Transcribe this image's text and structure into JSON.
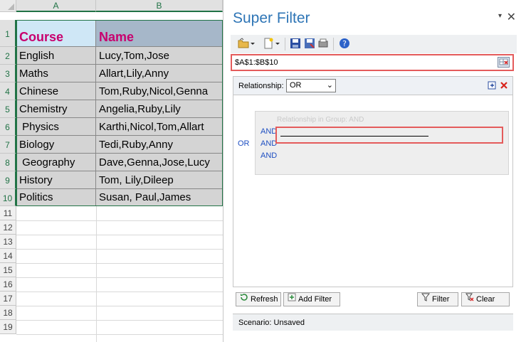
{
  "sheet": {
    "columns": [
      "A",
      "B"
    ],
    "rows": [
      "1",
      "2",
      "3",
      "4",
      "5",
      "6",
      "7",
      "8",
      "9",
      "10",
      "11",
      "12",
      "13",
      "14",
      "15",
      "16",
      "17",
      "18",
      "19"
    ],
    "header": {
      "course": "Course",
      "name": "Name"
    },
    "data": [
      [
        "English",
        "Lucy,Tom,Jose"
      ],
      [
        "Maths",
        "Allart,Lily,Anny"
      ],
      [
        "Chinese",
        "Tom,Ruby,Nicol,Genna"
      ],
      [
        "Chemistry",
        "Angelia,Ruby,Lily"
      ],
      [
        " Physics",
        "Karthi,Nicol,Tom,Allart"
      ],
      [
        "Biology",
        "Tedi,Ruby,Anny"
      ],
      [
        " Geography",
        "Dave,Genna,Jose,Lucy"
      ],
      [
        "History",
        "Tom, Lily,Dileep"
      ],
      [
        "Politics",
        "Susan, Paul,James"
      ]
    ]
  },
  "panel": {
    "title": "Super Filter",
    "close": "✕",
    "menu": "▾",
    "range": "$A$1:$B$10",
    "relationship_label": "Relationship:",
    "relationship_value": "OR",
    "outer_op": "OR",
    "group_title": "Relationship in Group:   AND",
    "and_ops": [
      "AND",
      "AND",
      "AND"
    ],
    "buttons": {
      "refresh": "Refresh",
      "add_filter": "Add Filter",
      "filter": "Filter",
      "clear": "Clear"
    },
    "scenario": "Scenario:  Unsaved"
  },
  "colors": {
    "accent": "#2e75b6",
    "highlight": "#e45b5b",
    "header_text": "#c8006e",
    "sheet_select": "#217346"
  }
}
